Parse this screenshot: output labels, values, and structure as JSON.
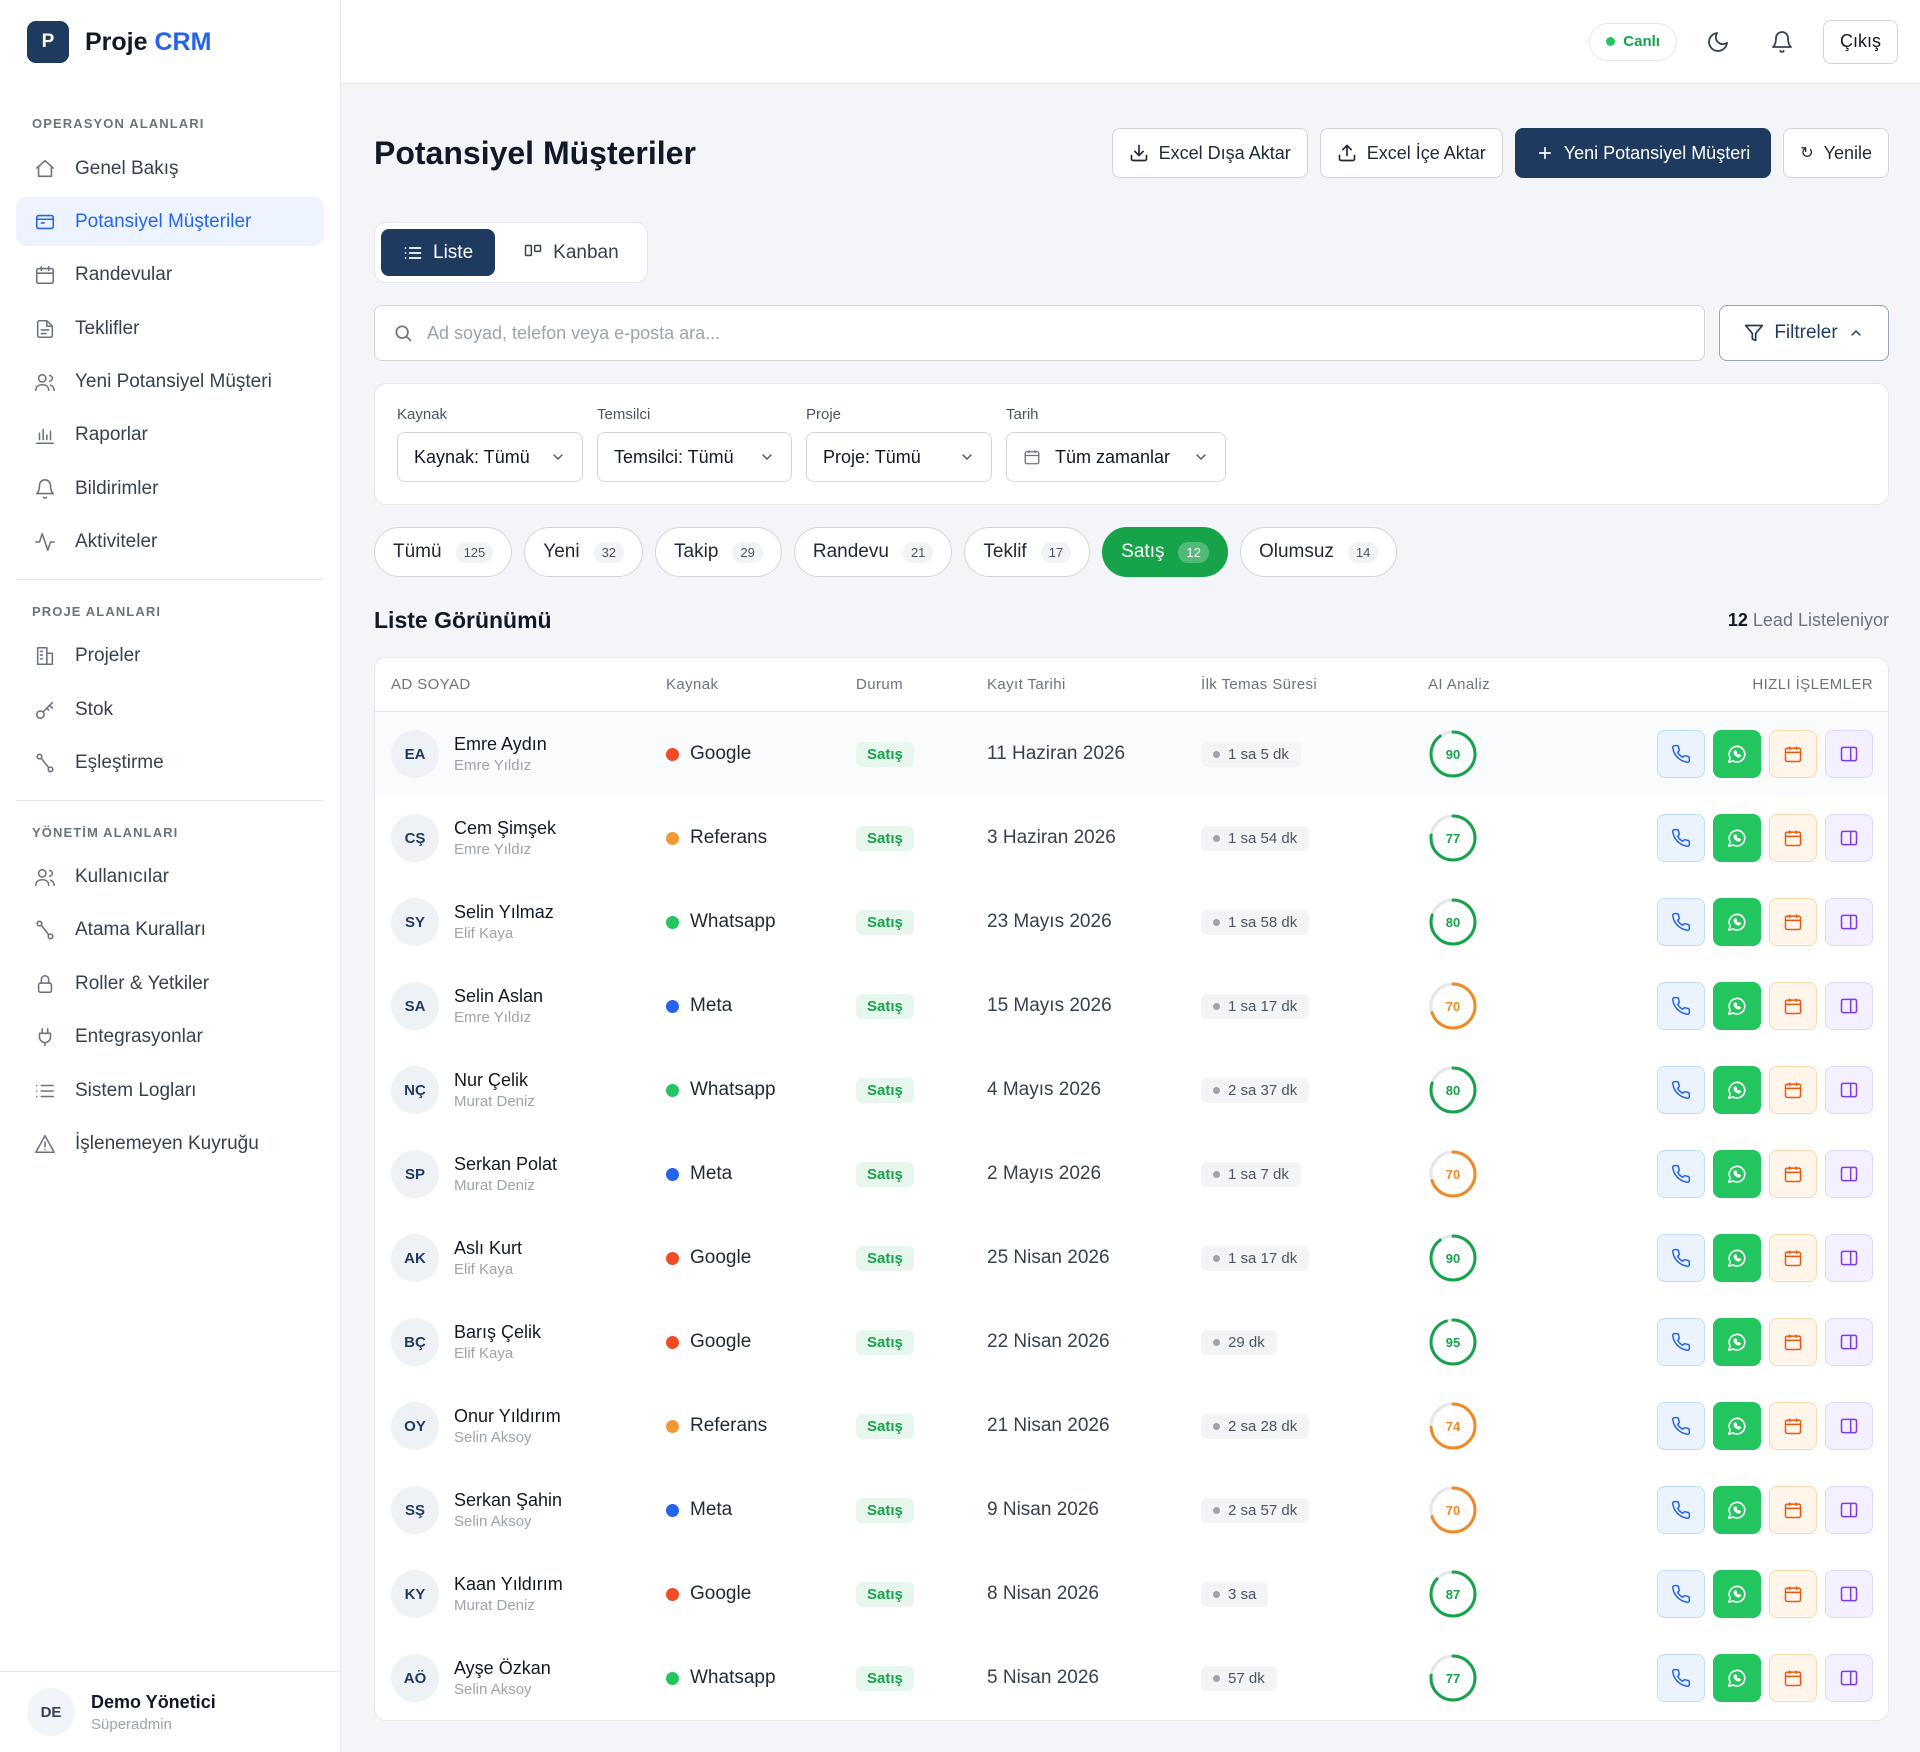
{
  "app": {
    "logo_letter": "P",
    "name": "Proje",
    "name_accent": "CRM"
  },
  "sidebar": {
    "sections": [
      {
        "title": "OPERASYON ALANLARI",
        "items": [
          {
            "label": "Genel Bakış",
            "icon": "home-icon",
            "active": false
          },
          {
            "label": "Potansiyel Müşteriler",
            "icon": "inbox-icon",
            "active": true
          },
          {
            "label": "Randevular",
            "icon": "calendar-icon",
            "active": false
          },
          {
            "label": "Teklifler",
            "icon": "document-icon",
            "active": false
          },
          {
            "label": "Yeni Potansiyel Müşteri",
            "icon": "users-icon",
            "active": false
          },
          {
            "label": "Raporlar",
            "icon": "bar-chart-icon",
            "active": false
          },
          {
            "label": "Bildirimler",
            "icon": "bell-icon",
            "active": false
          },
          {
            "label": "Aktiviteler",
            "icon": "activity-icon",
            "active": false
          }
        ]
      },
      {
        "title": "PROJE ALANLARI",
        "items": [
          {
            "label": "Projeler",
            "icon": "building-icon",
            "active": false
          },
          {
            "label": "Stok",
            "icon": "key-icon",
            "active": false
          },
          {
            "label": "Eşleştirme",
            "icon": "route-icon",
            "active": false
          }
        ]
      },
      {
        "title": "YÖNETİM ALANLARI",
        "items": [
          {
            "label": "Kullanıcılar",
            "icon": "users-icon",
            "active": false
          },
          {
            "label": "Atama Kuralları",
            "icon": "route-icon",
            "active": false
          },
          {
            "label": "Roller & Yetkiler",
            "icon": "lock-icon",
            "active": false
          },
          {
            "label": "Entegrasyonlar",
            "icon": "plug-icon",
            "active": false
          },
          {
            "label": "Sistem Logları",
            "icon": "list-icon",
            "active": false
          },
          {
            "label": "İşlenemeyen Kuyruğu",
            "icon": "warning-icon",
            "active": false
          }
        ]
      }
    ],
    "user": {
      "initials": "DE",
      "name": "Demo Yönetici",
      "role": "Süperadmin"
    }
  },
  "topbar": {
    "live_label": "Canlı",
    "logout_label": "Çıkış"
  },
  "page": {
    "title": "Potansiyel Müşteriler",
    "actions": {
      "export": "Excel Dışa Aktar",
      "import": "Excel İçe Aktar",
      "new": "Yeni Potansiyel Müşteri",
      "refresh": "Yenile"
    },
    "view_toggle": {
      "list": "Liste",
      "kanban": "Kanban"
    },
    "search": {
      "placeholder": "Ad soyad, telefon veya e-posta ara...",
      "value": ""
    },
    "filters_label": "Filtreler",
    "filters": [
      {
        "label": "Kaynak",
        "value": "Kaynak: Tümü"
      },
      {
        "label": "Temsilci",
        "value": "Temsilci: Tümü"
      },
      {
        "label": "Proje",
        "value": "Proje: Tümü"
      },
      {
        "label": "Tarih",
        "value": "Tüm zamanlar"
      }
    ],
    "status_tabs": [
      {
        "label": "Tümü",
        "count": "125",
        "active": false
      },
      {
        "label": "Yeni",
        "count": "32",
        "active": false
      },
      {
        "label": "Takip",
        "count": "29",
        "active": false
      },
      {
        "label": "Randevu",
        "count": "21",
        "active": false
      },
      {
        "label": "Teklif",
        "count": "17",
        "active": false
      },
      {
        "label": "Satış",
        "count": "12",
        "active": true
      },
      {
        "label": "Olumsuz",
        "count": "14",
        "active": false
      }
    ],
    "list_title": "Liste Görünümü",
    "list_count": "12",
    "list_count_suffix": "Lead Listeleniyor"
  },
  "table": {
    "columns": [
      "AD SOYAD",
      "Kaynak",
      "Durum",
      "Kayıt Tarihi",
      "İlk Temas Süresi",
      "AI Analiz",
      "HIZLI İŞLEMLER"
    ],
    "source_colors": {
      "Google": "#ef4b24",
      "Referans": "#f09a36",
      "Whatsapp": "#22c55e",
      "Meta": "#2563eb"
    },
    "score_colors": {
      "high": "#16a34a",
      "mid": "#f08a24"
    },
    "rows": [
      {
        "initials": "EA",
        "name": "Emre Aydın",
        "rep": "Emre Yıldız",
        "source": "Google",
        "status": "Satış",
        "date": "11 Haziran 2026",
        "first_contact": "1 sa 5 dk",
        "score": 90
      },
      {
        "initials": "CŞ",
        "name": "Cem Şimşek",
        "rep": "Emre Yıldız",
        "source": "Referans",
        "status": "Satış",
        "date": "3 Haziran 2026",
        "first_contact": "1 sa 54 dk",
        "score": 77
      },
      {
        "initials": "SY",
        "name": "Selin Yılmaz",
        "rep": "Elif Kaya",
        "source": "Whatsapp",
        "status": "Satış",
        "date": "23 Mayıs 2026",
        "first_contact": "1 sa 58 dk",
        "score": 80
      },
      {
        "initials": "SA",
        "name": "Selin Aslan",
        "rep": "Emre Yıldız",
        "source": "Meta",
        "status": "Satış",
        "date": "15 Mayıs 2026",
        "first_contact": "1 sa 17 dk",
        "score": 70
      },
      {
        "initials": "NÇ",
        "name": "Nur Çelik",
        "rep": "Murat Deniz",
        "source": "Whatsapp",
        "status": "Satış",
        "date": "4 Mayıs 2026",
        "first_contact": "2 sa 37 dk",
        "score": 80
      },
      {
        "initials": "SP",
        "name": "Serkan Polat",
        "rep": "Murat Deniz",
        "source": "Meta",
        "status": "Satış",
        "date": "2 Mayıs 2026",
        "first_contact": "1 sa 7 dk",
        "score": 70
      },
      {
        "initials": "AK",
        "name": "Aslı Kurt",
        "rep": "Elif Kaya",
        "source": "Google",
        "status": "Satış",
        "date": "25 Nisan 2026",
        "first_contact": "1 sa 17 dk",
        "score": 90
      },
      {
        "initials": "BÇ",
        "name": "Barış Çelik",
        "rep": "Elif Kaya",
        "source": "Google",
        "status": "Satış",
        "date": "22 Nisan 2026",
        "first_contact": "29 dk",
        "score": 95
      },
      {
        "initials": "OY",
        "name": "Onur Yıldırım",
        "rep": "Selin Aksoy",
        "source": "Referans",
        "status": "Satış",
        "date": "21 Nisan 2026",
        "first_contact": "2 sa 28 dk",
        "score": 74
      },
      {
        "initials": "SŞ",
        "name": "Serkan Şahin",
        "rep": "Selin Aksoy",
        "source": "Meta",
        "status": "Satış",
        "date": "9 Nisan 2026",
        "first_contact": "2 sa 57 dk",
        "score": 70
      },
      {
        "initials": "KY",
        "name": "Kaan Yıldırım",
        "rep": "Murat Deniz",
        "source": "Google",
        "status": "Satış",
        "date": "8 Nisan 2026",
        "first_contact": "3 sa",
        "score": 87
      },
      {
        "initials": "AÖ",
        "name": "Ayşe Özkan",
        "rep": "Selin Aksoy",
        "source": "Whatsapp",
        "status": "Satış",
        "date": "5 Nisan 2026",
        "first_contact": "57 dk",
        "score": 77
      }
    ]
  }
}
